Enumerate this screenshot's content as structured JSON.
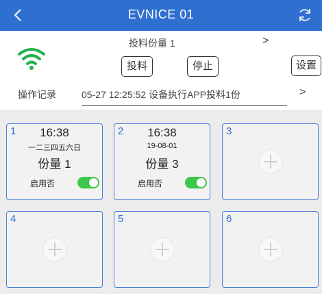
{
  "header": {
    "title": "EVNICE 01",
    "back_icon": "chevron-left-icon",
    "refresh_icon": "refresh-icon"
  },
  "controls": {
    "portion_label": "投料份量 1",
    "portion_arrow": ">",
    "feed_label": "投料",
    "stop_label": "停止",
    "settings_label": "设置",
    "log_label": "操作记录",
    "log_text": "05-27 12:25:52 设备执行APP投料1份",
    "log_arrow": ">"
  },
  "schedules": [
    {
      "num": "1",
      "time": "16:38",
      "days": "一二三四五六日",
      "portion": "份量 1",
      "enable_label": "启用否",
      "enabled": true
    },
    {
      "num": "2",
      "time": "16:38",
      "days": "19-08-01",
      "portion": "份量 3",
      "enable_label": "启用否",
      "enabled": true
    },
    {
      "num": "3",
      "empty": true
    },
    {
      "num": "4",
      "empty": true
    },
    {
      "num": "5",
      "empty": true
    },
    {
      "num": "6",
      "empty": true
    }
  ],
  "colors": {
    "header_bg": "#2f6fd0",
    "card_border": "#4a7fd6",
    "toggle_on": "#3cc84a",
    "wifi": "#22b14c"
  }
}
